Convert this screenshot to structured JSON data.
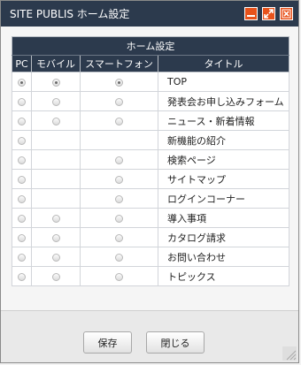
{
  "window": {
    "title": "SITE PUBLIS ホーム設定"
  },
  "table": {
    "group_header": "ホーム設定",
    "columns": [
      "PC",
      "モバイル",
      "スマートフォン",
      "タイトル"
    ],
    "rows": [
      {
        "title": "TOP",
        "pc": "on",
        "mobile": "on",
        "smartphone": "on"
      },
      {
        "title": "発表会お申し込みフォーム",
        "pc": "off",
        "mobile": "off",
        "smartphone": "off"
      },
      {
        "title": "ニュース・新着情報",
        "pc": "off",
        "mobile": "off",
        "smartphone": "off"
      },
      {
        "title": "新機能の紹介",
        "pc": "off",
        "mobile": "none",
        "smartphone": "none"
      },
      {
        "title": "検索ページ",
        "pc": "off",
        "mobile": "none",
        "smartphone": "off"
      },
      {
        "title": "サイトマップ",
        "pc": "off",
        "mobile": "none",
        "smartphone": "off"
      },
      {
        "title": "ログインコーナー",
        "pc": "off",
        "mobile": "none",
        "smartphone": "off"
      },
      {
        "title": "導入事項",
        "pc": "off",
        "mobile": "off",
        "smartphone": "off"
      },
      {
        "title": "カタログ請求",
        "pc": "off",
        "mobile": "off",
        "smartphone": "off"
      },
      {
        "title": "お問い合わせ",
        "pc": "off",
        "mobile": "off",
        "smartphone": "off"
      },
      {
        "title": "トピックス",
        "pc": "off",
        "mobile": "off",
        "smartphone": "off"
      }
    ]
  },
  "buttons": {
    "save_label": "保存",
    "close_label": "閉じる"
  },
  "colors": {
    "titlebar": "#2c3a4d",
    "window_button": "#e8521b"
  },
  "icons": [
    "minimize-icon",
    "maximize-icon",
    "close-icon",
    "resize-grip-icon"
  ]
}
